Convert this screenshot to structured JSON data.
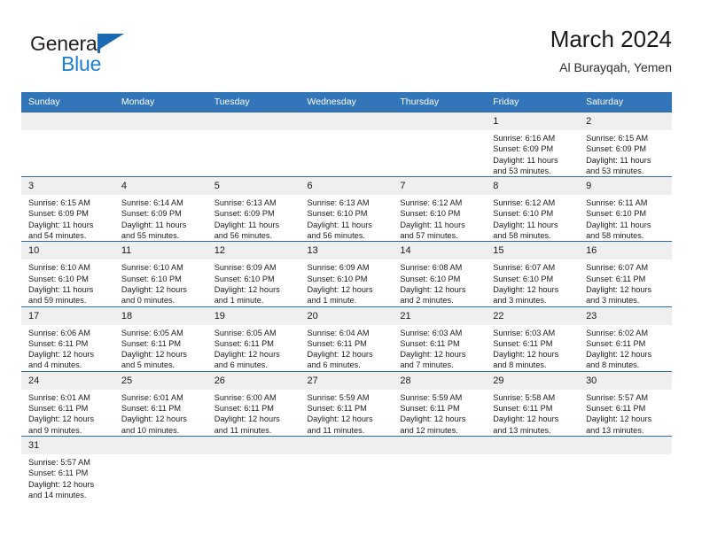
{
  "brand": {
    "name_top": "General",
    "name_bottom": "Blue",
    "flag_icon": "blue-flag-triangle",
    "color_dark": "#231f20",
    "color_blue": "#1b7fd4"
  },
  "header": {
    "title": "March 2024",
    "subtitle": "Al Burayqah, Yemen"
  },
  "theme": {
    "header_row_bg": "#3275b8",
    "daynum_bg": "#efefef",
    "row_divider": "#2f6ca8"
  },
  "calendar": {
    "weekday_headers": [
      "Sunday",
      "Monday",
      "Tuesday",
      "Wednesday",
      "Thursday",
      "Friday",
      "Saturday"
    ],
    "weeks": [
      [
        {
          "day": "",
          "lines": []
        },
        {
          "day": "",
          "lines": []
        },
        {
          "day": "",
          "lines": []
        },
        {
          "day": "",
          "lines": []
        },
        {
          "day": "",
          "lines": []
        },
        {
          "day": "1",
          "lines": [
            "Sunrise: 6:16 AM",
            "Sunset: 6:09 PM",
            "Daylight: 11 hours",
            "and 53 minutes."
          ]
        },
        {
          "day": "2",
          "lines": [
            "Sunrise: 6:15 AM",
            "Sunset: 6:09 PM",
            "Daylight: 11 hours",
            "and 53 minutes."
          ]
        }
      ],
      [
        {
          "day": "3",
          "lines": [
            "Sunrise: 6:15 AM",
            "Sunset: 6:09 PM",
            "Daylight: 11 hours",
            "and 54 minutes."
          ]
        },
        {
          "day": "4",
          "lines": [
            "Sunrise: 6:14 AM",
            "Sunset: 6:09 PM",
            "Daylight: 11 hours",
            "and 55 minutes."
          ]
        },
        {
          "day": "5",
          "lines": [
            "Sunrise: 6:13 AM",
            "Sunset: 6:09 PM",
            "Daylight: 11 hours",
            "and 56 minutes."
          ]
        },
        {
          "day": "6",
          "lines": [
            "Sunrise: 6:13 AM",
            "Sunset: 6:10 PM",
            "Daylight: 11 hours",
            "and 56 minutes."
          ]
        },
        {
          "day": "7",
          "lines": [
            "Sunrise: 6:12 AM",
            "Sunset: 6:10 PM",
            "Daylight: 11 hours",
            "and 57 minutes."
          ]
        },
        {
          "day": "8",
          "lines": [
            "Sunrise: 6:12 AM",
            "Sunset: 6:10 PM",
            "Daylight: 11 hours",
            "and 58 minutes."
          ]
        },
        {
          "day": "9",
          "lines": [
            "Sunrise: 6:11 AM",
            "Sunset: 6:10 PM",
            "Daylight: 11 hours",
            "and 58 minutes."
          ]
        }
      ],
      [
        {
          "day": "10",
          "lines": [
            "Sunrise: 6:10 AM",
            "Sunset: 6:10 PM",
            "Daylight: 11 hours",
            "and 59 minutes."
          ]
        },
        {
          "day": "11",
          "lines": [
            "Sunrise: 6:10 AM",
            "Sunset: 6:10 PM",
            "Daylight: 12 hours",
            "and 0 minutes."
          ]
        },
        {
          "day": "12",
          "lines": [
            "Sunrise: 6:09 AM",
            "Sunset: 6:10 PM",
            "Daylight: 12 hours",
            "and 1 minute."
          ]
        },
        {
          "day": "13",
          "lines": [
            "Sunrise: 6:09 AM",
            "Sunset: 6:10 PM",
            "Daylight: 12 hours",
            "and 1 minute."
          ]
        },
        {
          "day": "14",
          "lines": [
            "Sunrise: 6:08 AM",
            "Sunset: 6:10 PM",
            "Daylight: 12 hours",
            "and 2 minutes."
          ]
        },
        {
          "day": "15",
          "lines": [
            "Sunrise: 6:07 AM",
            "Sunset: 6:10 PM",
            "Daylight: 12 hours",
            "and 3 minutes."
          ]
        },
        {
          "day": "16",
          "lines": [
            "Sunrise: 6:07 AM",
            "Sunset: 6:11 PM",
            "Daylight: 12 hours",
            "and 3 minutes."
          ]
        }
      ],
      [
        {
          "day": "17",
          "lines": [
            "Sunrise: 6:06 AM",
            "Sunset: 6:11 PM",
            "Daylight: 12 hours",
            "and 4 minutes."
          ]
        },
        {
          "day": "18",
          "lines": [
            "Sunrise: 6:05 AM",
            "Sunset: 6:11 PM",
            "Daylight: 12 hours",
            "and 5 minutes."
          ]
        },
        {
          "day": "19",
          "lines": [
            "Sunrise: 6:05 AM",
            "Sunset: 6:11 PM",
            "Daylight: 12 hours",
            "and 6 minutes."
          ]
        },
        {
          "day": "20",
          "lines": [
            "Sunrise: 6:04 AM",
            "Sunset: 6:11 PM",
            "Daylight: 12 hours",
            "and 6 minutes."
          ]
        },
        {
          "day": "21",
          "lines": [
            "Sunrise: 6:03 AM",
            "Sunset: 6:11 PM",
            "Daylight: 12 hours",
            "and 7 minutes."
          ]
        },
        {
          "day": "22",
          "lines": [
            "Sunrise: 6:03 AM",
            "Sunset: 6:11 PM",
            "Daylight: 12 hours",
            "and 8 minutes."
          ]
        },
        {
          "day": "23",
          "lines": [
            "Sunrise: 6:02 AM",
            "Sunset: 6:11 PM",
            "Daylight: 12 hours",
            "and 8 minutes."
          ]
        }
      ],
      [
        {
          "day": "24",
          "lines": [
            "Sunrise: 6:01 AM",
            "Sunset: 6:11 PM",
            "Daylight: 12 hours",
            "and 9 minutes."
          ]
        },
        {
          "day": "25",
          "lines": [
            "Sunrise: 6:01 AM",
            "Sunset: 6:11 PM",
            "Daylight: 12 hours",
            "and 10 minutes."
          ]
        },
        {
          "day": "26",
          "lines": [
            "Sunrise: 6:00 AM",
            "Sunset: 6:11 PM",
            "Daylight: 12 hours",
            "and 11 minutes."
          ]
        },
        {
          "day": "27",
          "lines": [
            "Sunrise: 5:59 AM",
            "Sunset: 6:11 PM",
            "Daylight: 12 hours",
            "and 11 minutes."
          ]
        },
        {
          "day": "28",
          "lines": [
            "Sunrise: 5:59 AM",
            "Sunset: 6:11 PM",
            "Daylight: 12 hours",
            "and 12 minutes."
          ]
        },
        {
          "day": "29",
          "lines": [
            "Sunrise: 5:58 AM",
            "Sunset: 6:11 PM",
            "Daylight: 12 hours",
            "and 13 minutes."
          ]
        },
        {
          "day": "30",
          "lines": [
            "Sunrise: 5:57 AM",
            "Sunset: 6:11 PM",
            "Daylight: 12 hours",
            "and 13 minutes."
          ]
        }
      ],
      [
        {
          "day": "31",
          "lines": [
            "Sunrise: 5:57 AM",
            "Sunset: 6:11 PM",
            "Daylight: 12 hours",
            "and 14 minutes."
          ]
        },
        {
          "day": "",
          "lines": []
        },
        {
          "day": "",
          "lines": []
        },
        {
          "day": "",
          "lines": []
        },
        {
          "day": "",
          "lines": []
        },
        {
          "day": "",
          "lines": []
        },
        {
          "day": "",
          "lines": []
        }
      ]
    ]
  }
}
